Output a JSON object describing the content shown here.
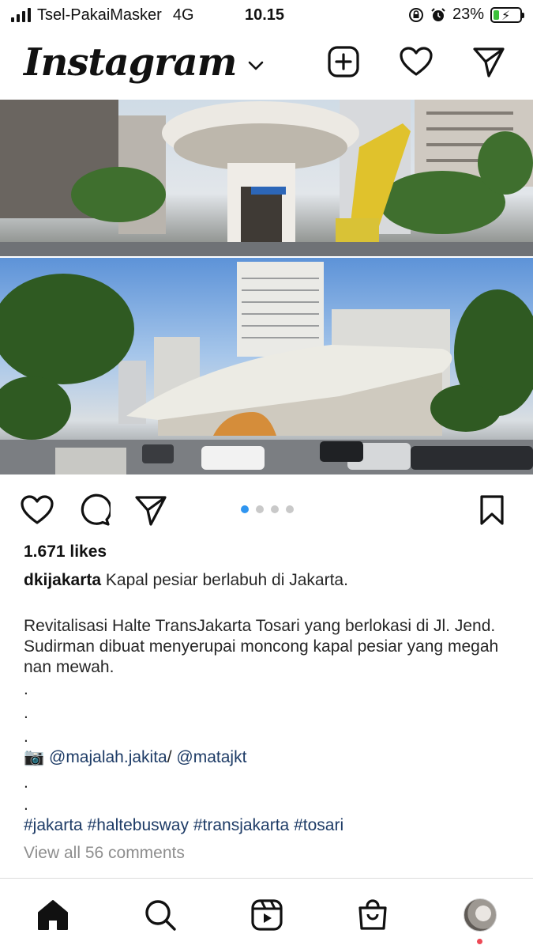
{
  "status_bar": {
    "carrier": "Tsel-PakaiMasker",
    "network": "4G",
    "time": "10.15",
    "battery_percent": "23%",
    "battery_level": 0.23,
    "icons": [
      "signal-icon",
      "orientation-lock-icon",
      "alarm-icon",
      "battery-icon"
    ]
  },
  "header": {
    "logo": "Instagram",
    "icons": [
      "chevron-down-icon",
      "new-post-icon",
      "heart-icon",
      "direct-message-icon"
    ]
  },
  "post": {
    "image_count": 4,
    "active_image_index": 1,
    "likes": "1.671 likes",
    "username": "dkijakarta",
    "caption_first_line": "Kapal pesiar berlabuh di Jakarta.",
    "caption_body": "Revitalisasi Halte TransJakarta Tosari yang berlokasi di Jl. Jend. Sudirman dibuat menyerupai moncong kapal pesiar yang megah nan mewah.",
    "dots": [
      ".",
      ".",
      "."
    ],
    "credit_emoji": "📷",
    "credit_mention_1": "@majalah.jakita",
    "credit_separator": "/",
    "credit_mention_2": "@matajkt",
    "dots_after": [
      ".",
      "."
    ],
    "hashtags": [
      "#jakarta",
      "#haltebusway",
      "#transjakarta",
      "#tosari"
    ],
    "view_comments": "View all 56 comments"
  },
  "bottom_nav": {
    "items": [
      "home-icon",
      "search-icon",
      "reels-icon",
      "shop-icon",
      "profile-avatar"
    ]
  },
  "colors": {
    "accent_blue": "#2f95f0",
    "hashtag": "#1d3b66",
    "muted": "#8e8e8e",
    "notification": "#ed4956"
  }
}
